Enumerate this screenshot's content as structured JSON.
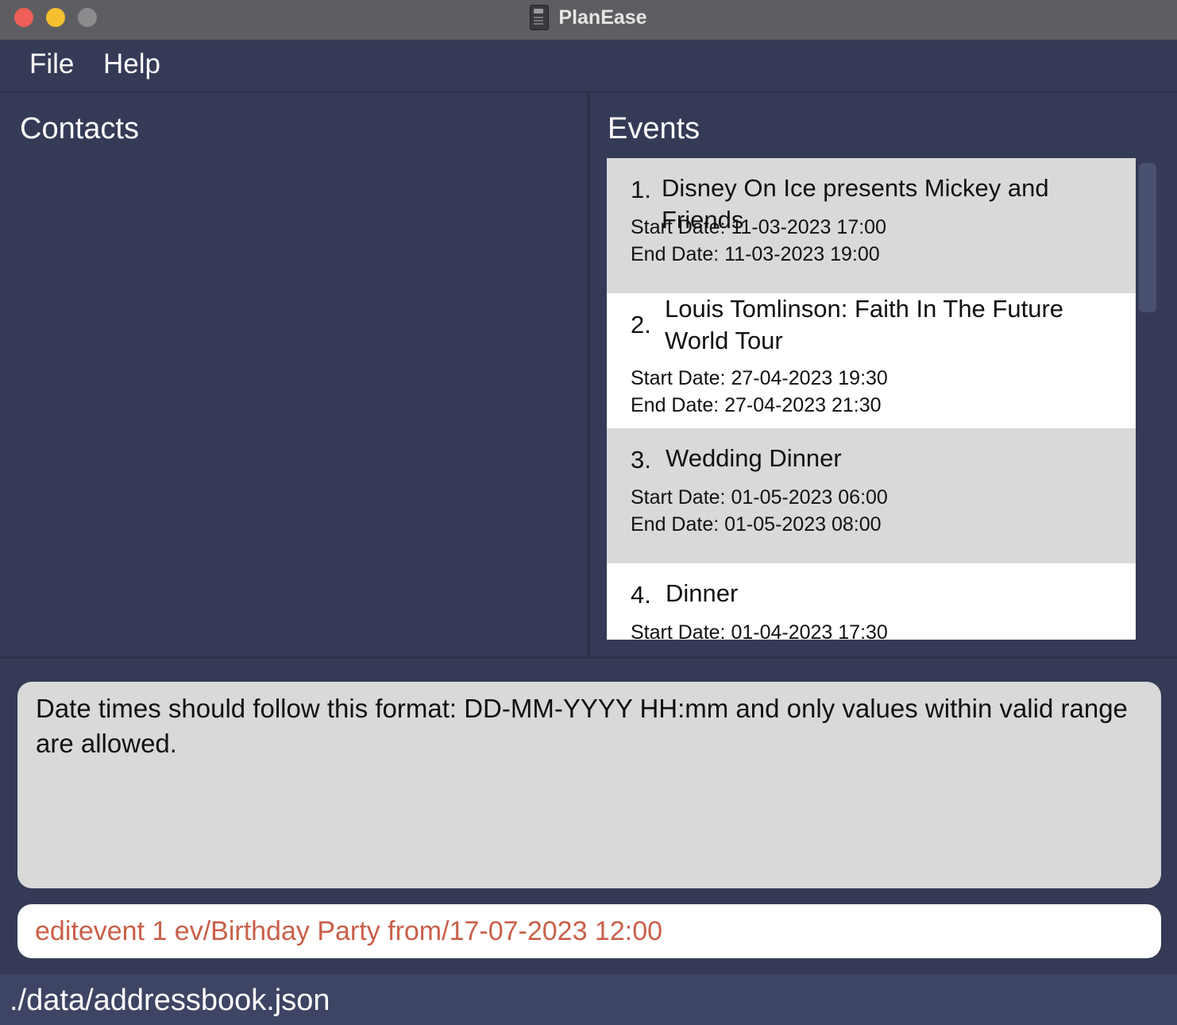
{
  "window": {
    "title": "PlanEase"
  },
  "menu": {
    "file": "File",
    "help": "Help"
  },
  "contacts": {
    "title": "Contacts"
  },
  "events": {
    "title": "Events",
    "items": [
      {
        "num": "1.",
        "name": "Disney On Ice presents Mickey and Friends",
        "start": "Start Date: 11-03-2023 17:00",
        "end": "End Date: 11-03-2023 19:00"
      },
      {
        "num": "2.",
        "name": "Louis Tomlinson: Faith In The Future World Tour",
        "start": "Start Date: 27-04-2023 19:30",
        "end": "End Date: 27-04-2023 21:30"
      },
      {
        "num": "3.",
        "name": "Wedding Dinner",
        "start": "Start Date: 01-05-2023 06:00",
        "end": "End Date: 01-05-2023 08:00"
      },
      {
        "num": "4.",
        "name": "Dinner",
        "start": "Start Date: 01-04-2023 17:30"
      }
    ]
  },
  "result": {
    "message": "Date times should follow this format: DD-MM-YYYY HH:mm and only values within valid range are allowed."
  },
  "command": {
    "value": "editevent 1 ev/Birthday Party from/17-07-2023 12:00"
  },
  "status": {
    "path": "./data/addressbook.json"
  },
  "colors": {
    "background": "#353b56",
    "command_error_text": "#c9604a",
    "card_alt": "#d9d9d9"
  }
}
